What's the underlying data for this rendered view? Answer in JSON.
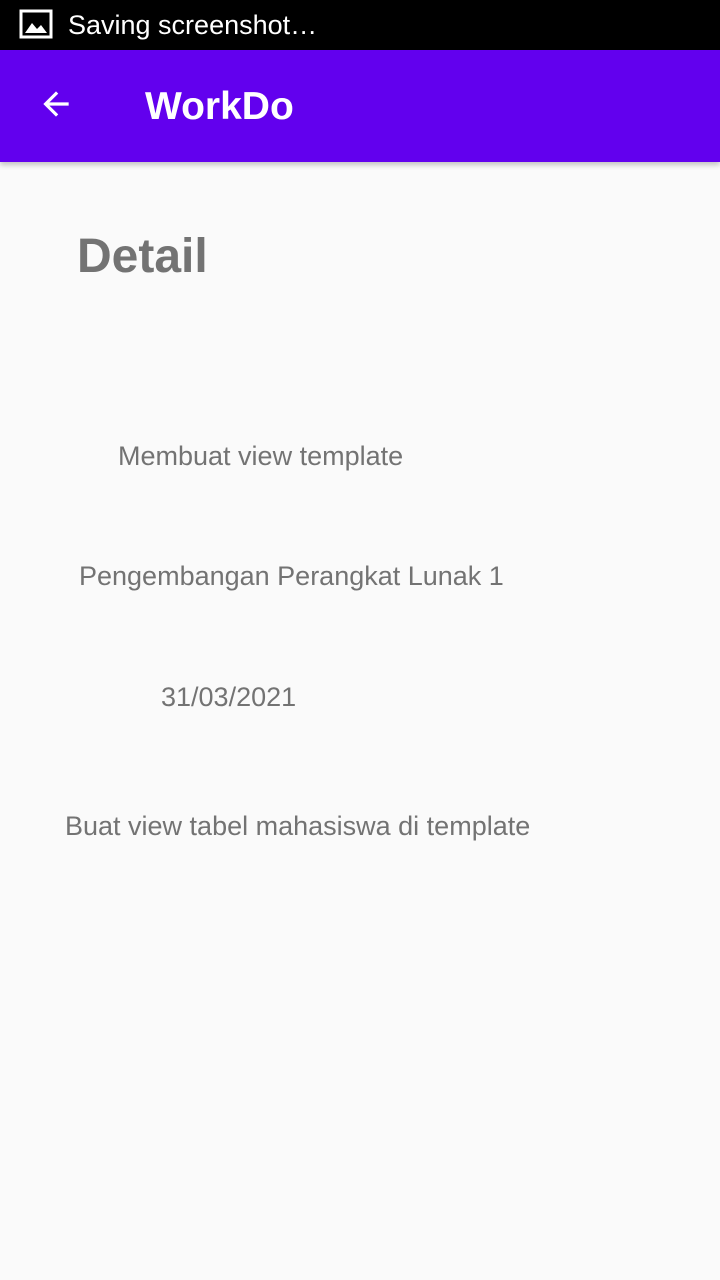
{
  "status_bar": {
    "text": "Saving screenshot…",
    "icon": "image-icon"
  },
  "app_bar": {
    "title": "WorkDo",
    "back_icon": "arrow-left-icon",
    "background_color": "#6200EE"
  },
  "detail": {
    "heading": "Detail",
    "task_title": "Membuat view template",
    "course": "Pengembangan Perangkat Lunak 1",
    "due_date": "31/03/2021",
    "description": "Buat view tabel mahasiswa di template"
  }
}
